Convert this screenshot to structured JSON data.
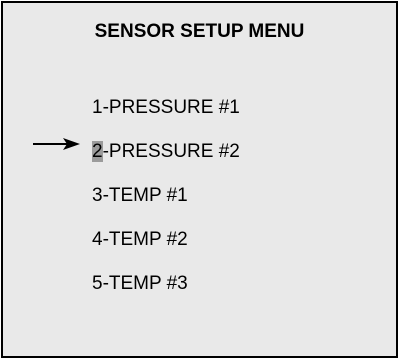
{
  "title": "SENSOR SETUP MENU",
  "selected_index": 1,
  "selector": {
    "icon": "right-arrow-icon"
  },
  "highlight_color": "#9b9b9b",
  "items": [
    {
      "number": "1",
      "label": "-PRESSURE #1"
    },
    {
      "number": "2",
      "label": "-PRESSURE #2"
    },
    {
      "number": "3",
      "label": "-TEMP #1"
    },
    {
      "number": "4",
      "label": "-TEMP #2"
    },
    {
      "number": "5",
      "label": "-TEMP #3"
    }
  ]
}
